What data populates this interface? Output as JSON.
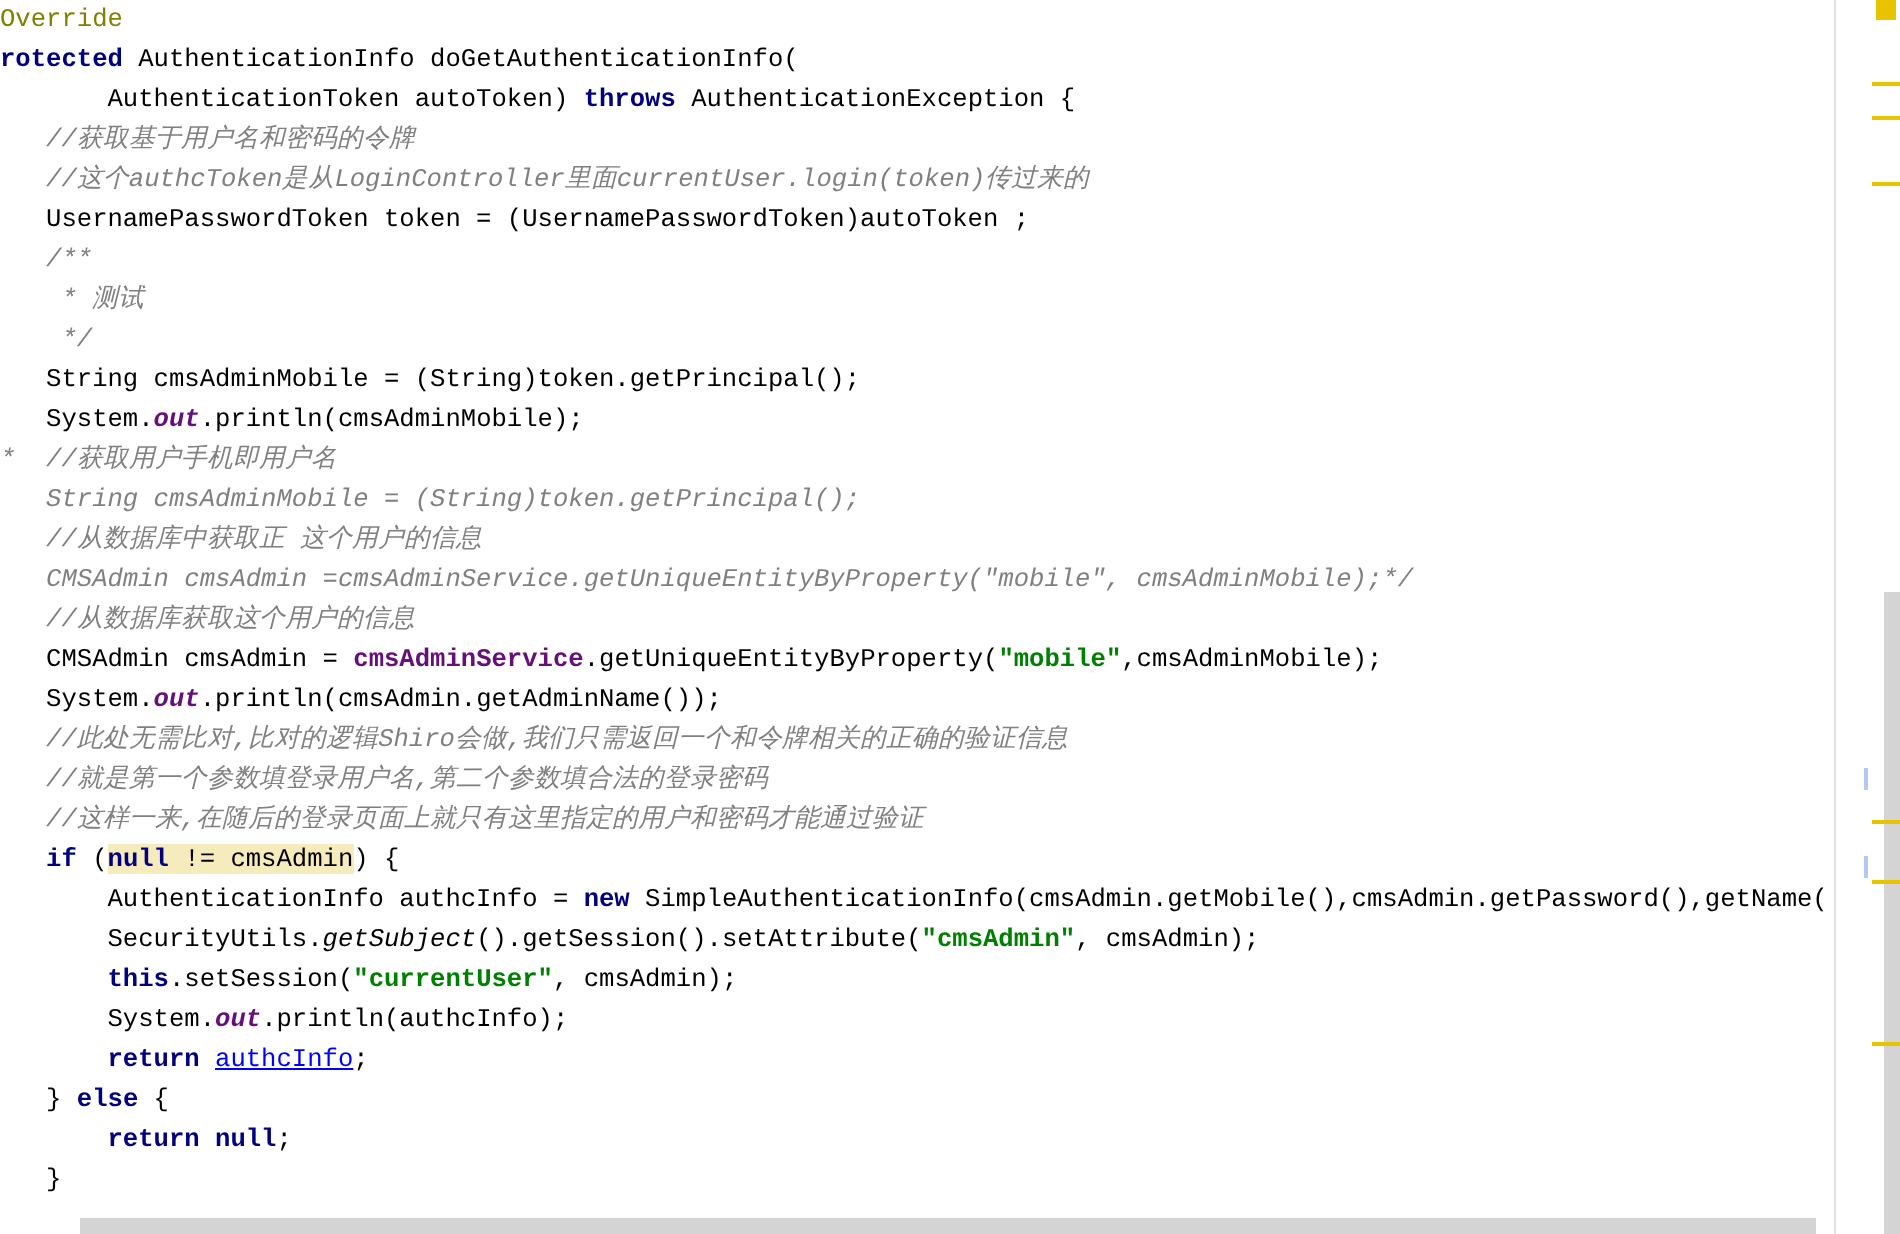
{
  "editor": {
    "lines": [
      {
        "segments": [
          {
            "text": "Override",
            "kind": "annotation"
          }
        ]
      },
      {
        "segments": [
          {
            "text": "rotected",
            "kind": "keyword"
          },
          {
            "text": " AuthenticationInfo doGetAuthenticationInfo(",
            "kind": "plain"
          }
        ]
      },
      {
        "segments": [
          {
            "text": "       AuthenticationToken autoToken) ",
            "kind": "plain"
          },
          {
            "text": "throws",
            "kind": "keyword"
          },
          {
            "text": " AuthenticationException {",
            "kind": "plain"
          }
        ]
      },
      {
        "segments": [
          {
            "text": "   //获取基于用户名和密码的令牌",
            "kind": "comment"
          }
        ]
      },
      {
        "segments": [
          {
            "text": "   //这个authcToken是从LoginController里面currentUser.login(token)传过来的",
            "kind": "comment"
          }
        ]
      },
      {
        "segments": [
          {
            "text": "   UsernamePasswordToken token = (UsernamePasswordToken)autoToken ;",
            "kind": "plain"
          }
        ]
      },
      {
        "segments": [
          {
            "text": "   /**",
            "kind": "comment"
          }
        ]
      },
      {
        "segments": [
          {
            "text": "    * 测试",
            "kind": "comment"
          }
        ]
      },
      {
        "segments": [
          {
            "text": "    */",
            "kind": "comment"
          }
        ]
      },
      {
        "segments": [
          {
            "text": "   String cmsAdminMobile = (String)token.getPrincipal();",
            "kind": "plain"
          }
        ]
      },
      {
        "segments": [
          {
            "text": "   System.",
            "kind": "plain"
          },
          {
            "text": "out",
            "kind": "field"
          },
          {
            "text": ".println(cmsAdminMobile);",
            "kind": "plain"
          }
        ]
      },
      {
        "segments": [
          {
            "text": "*  //获取用户手机即用户名",
            "kind": "comment"
          }
        ]
      },
      {
        "segments": [
          {
            "text": "   String cmsAdminMobile = (String)token.getPrincipal();",
            "kind": "comment"
          }
        ]
      },
      {
        "segments": [
          {
            "text": "   //从数据库中获取正 这个用户的信息",
            "kind": "comment"
          }
        ]
      },
      {
        "segments": [
          {
            "text": "   CMSAdmin cmsAdmin =cmsAdminService.getUniqueEntityByProperty(\"mobile\", cmsAdminMobile);*/",
            "kind": "comment"
          }
        ]
      },
      {
        "segments": [
          {
            "text": "   //从数据库获取这个用户的信息",
            "kind": "comment"
          }
        ]
      },
      {
        "segments": [
          {
            "text": "   CMSAdmin cmsAdmin = ",
            "kind": "plain"
          },
          {
            "text": "cmsAdminService",
            "kind": "member"
          },
          {
            "text": ".getUniqueEntityByProperty(",
            "kind": "plain"
          },
          {
            "text": "\"mobile\"",
            "kind": "string"
          },
          {
            "text": ",cmsAdminMobile);",
            "kind": "plain"
          }
        ]
      },
      {
        "segments": [
          {
            "text": "   System.",
            "kind": "plain"
          },
          {
            "text": "out",
            "kind": "field"
          },
          {
            "text": ".println(cmsAdmin.getAdminName());",
            "kind": "plain"
          }
        ]
      },
      {
        "segments": [
          {
            "text": "   //此处无需比对,比对的逻辑Shiro会做,我们只需返回一个和令牌相关的正确的验证信息",
            "kind": "comment"
          }
        ]
      },
      {
        "segments": [
          {
            "text": "   //就是第一个参数填登录用户名,第二个参数填合法的登录密码",
            "kind": "comment"
          }
        ]
      },
      {
        "segments": [
          {
            "text": "   //这样一来,在随后的登录页面上就只有这里指定的用户和密码才能通过验证",
            "kind": "comment"
          }
        ]
      },
      {
        "segments": [
          {
            "text": "   if",
            "kind": "keyword"
          },
          {
            "text": " (",
            "kind": "plain"
          },
          {
            "text": "null",
            "kind": "highlight-keyword"
          },
          {
            "text": " != cmsAdmin",
            "kind": "highlight"
          },
          {
            "text": ") {",
            "kind": "plain"
          }
        ]
      },
      {
        "segments": [
          {
            "text": "       AuthenticationInfo authcInfo = ",
            "kind": "plain"
          },
          {
            "text": "new",
            "kind": "keyword"
          },
          {
            "text": " SimpleAuthenticationInfo(cmsAdmin.getMobile(),cmsAdmin.getPassword(),getName(",
            "kind": "plain"
          }
        ]
      },
      {
        "segments": [
          {
            "text": "       SecurityUtils.",
            "kind": "plain"
          },
          {
            "text": "getSubject",
            "kind": "static-method"
          },
          {
            "text": "().getSession().setAttribute(",
            "kind": "plain"
          },
          {
            "text": "\"cmsAdmin\"",
            "kind": "string"
          },
          {
            "text": ", cmsAdmin);",
            "kind": "plain"
          }
        ]
      },
      {
        "segments": [
          {
            "text": "       this",
            "kind": "keyword"
          },
          {
            "text": ".setSession(",
            "kind": "plain"
          },
          {
            "text": "\"currentUser\"",
            "kind": "string"
          },
          {
            "text": ", cmsAdmin);",
            "kind": "plain"
          }
        ]
      },
      {
        "segments": [
          {
            "text": "       System.",
            "kind": "plain"
          },
          {
            "text": "out",
            "kind": "field"
          },
          {
            "text": ".println(authcInfo);",
            "kind": "plain"
          }
        ]
      },
      {
        "segments": [
          {
            "text": "       return ",
            "kind": "keyword"
          },
          {
            "text": "authcInfo",
            "kind": "link"
          },
          {
            "text": ";",
            "kind": "plain"
          }
        ]
      },
      {
        "segments": [
          {
            "text": "   } ",
            "kind": "plain"
          },
          {
            "text": "else",
            "kind": "keyword"
          },
          {
            "text": " {",
            "kind": "plain"
          }
        ]
      },
      {
        "segments": [
          {
            "text": "       return null",
            "kind": "keyword"
          },
          {
            "text": ";",
            "kind": "plain"
          }
        ]
      },
      {
        "segments": [
          {
            "text": "   }",
            "kind": "plain"
          }
        ]
      }
    ]
  }
}
